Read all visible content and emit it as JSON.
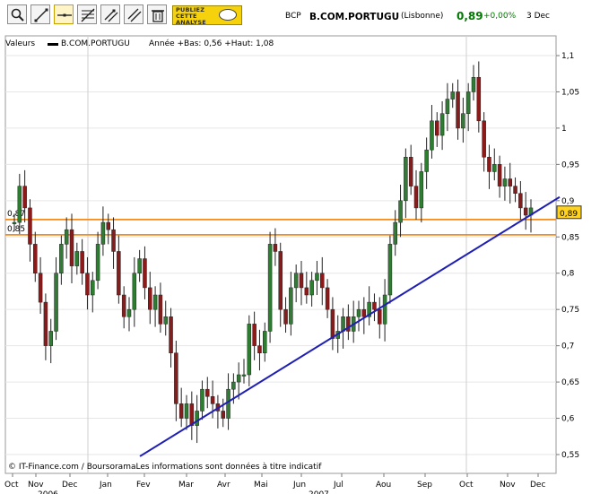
{
  "toolbar": {
    "tools": [
      {
        "name": "zoom-tool",
        "icon": "magnifier-icon"
      },
      {
        "name": "line-tool",
        "icon": "line-icon"
      },
      {
        "name": "horizontal-line-tool",
        "icon": "horizontal-line-icon"
      },
      {
        "name": "fibonacci-tool",
        "icon": "fibonacci-icon"
      },
      {
        "name": "trend-channel-tool",
        "icon": "channel-icon"
      },
      {
        "name": "parallel-lines-tool",
        "icon": "parallel-icon"
      },
      {
        "name": "delete-tool",
        "icon": "trash-icon"
      }
    ],
    "ad_text": "PUBLIEZ CETTE ANALYSE"
  },
  "header": {
    "symbol": "BCP",
    "name": "B.COM.PORTUGU",
    "market": "(Lisbonne)",
    "last": "0,89",
    "change": "+0,00%",
    "date": "3 Dec"
  },
  "legend": {
    "label": "Valeurs",
    "series": "B.COM.PORTUGU",
    "stats": "Année +Bas: 0,56 +Haut: 1,08"
  },
  "footer": "© IT-Finance.com / BoursoramaLes informations sont données à titre indicatif",
  "colors": {
    "up_candle": "#2e7d32",
    "down_candle": "#8b1a1a",
    "trendline": "#1f1fb4",
    "resistance": "#f28c1e",
    "price_tag": "#ffd21f"
  },
  "chart_data": {
    "type": "candlestick",
    "y_ticks": [
      "1,1",
      "1,05",
      "1",
      "0,95",
      "0,9",
      "0,85",
      "0,8",
      "0,75",
      "0,7",
      "0,65",
      "0,6",
      "0,55"
    ],
    "ylim": [
      0.54,
      1.11
    ],
    "x_ticks": [
      "Oct",
      "Nov",
      "Dec",
      "Jan",
      "Fev",
      "Mar",
      "Avr",
      "Mai",
      "Jun",
      "Jul",
      "Aou",
      "Sep",
      "Oct",
      "Nov",
      "Dec"
    ],
    "x_sub": [
      "2006",
      "2007"
    ],
    "grid": true,
    "horizontal_lines": [
      {
        "label": "0,87",
        "value": 0.874
      },
      {
        "label": "0,85",
        "value": 0.853
      }
    ],
    "trendline": {
      "from": {
        "x": "Fev",
        "y": 0.555
      },
      "to": {
        "x": "Dec",
        "y": 0.905
      }
    },
    "last_price": "0,89",
    "close_series": [
      0.87,
      0.92,
      0.89,
      0.84,
      0.8,
      0.76,
      0.7,
      0.72,
      0.8,
      0.84,
      0.86,
      0.81,
      0.83,
      0.8,
      0.77,
      0.79,
      0.84,
      0.87,
      0.86,
      0.83,
      0.77,
      0.74,
      0.75,
      0.8,
      0.82,
      0.78,
      0.75,
      0.77,
      0.73,
      0.74,
      0.69,
      0.62,
      0.6,
      0.62,
      0.59,
      0.61,
      0.64,
      0.63,
      0.62,
      0.61,
      0.6,
      0.64,
      0.65,
      0.66,
      0.66,
      0.73,
      0.7,
      0.69,
      0.72,
      0.84,
      0.83,
      0.75,
      0.73,
      0.78,
      0.8,
      0.78,
      0.77,
      0.79,
      0.8,
      0.78,
      0.75,
      0.71,
      0.72,
      0.74,
      0.72,
      0.74,
      0.75,
      0.74,
      0.76,
      0.75,
      0.73,
      0.77,
      0.84,
      0.87,
      0.9,
      0.96,
      0.92,
      0.89,
      0.94,
      0.97,
      1.01,
      0.99,
      1.02,
      1.04,
      1.05,
      1.0,
      1.02,
      1.05,
      1.07,
      1.01,
      0.96,
      0.94,
      0.95,
      0.92,
      0.93,
      0.92,
      0.91,
      0.89,
      0.88,
      0.89
    ]
  }
}
